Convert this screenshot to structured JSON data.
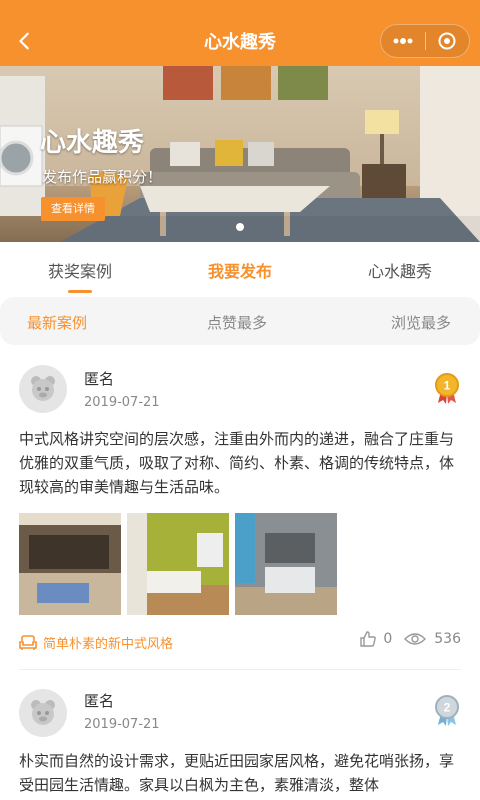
{
  "header": {
    "title": "心水趣秀"
  },
  "banner": {
    "title": "心水趣秀",
    "subtitle": "发布作品赢积分！",
    "button": "查看详情"
  },
  "tabs": [
    {
      "label": "获奖案例"
    },
    {
      "label": "我要发布"
    },
    {
      "label": "心水趣秀"
    }
  ],
  "filters": [
    {
      "label": "最新案例"
    },
    {
      "label": "点赞最多"
    },
    {
      "label": "浏览最多"
    }
  ],
  "posts": [
    {
      "author": "匿名",
      "date": "2019-07-21",
      "badge": "1",
      "content": "中式风格讲究空间的层次感，注重由外而内的递进，融合了庄重与优雅的双重气质，吸取了对称、简约、朴素、格调的传统特点，体现较高的审美情趣与生活品味。",
      "tag": "简单朴素的新中式风格",
      "likes": "0",
      "views": "536"
    },
    {
      "author": "匿名",
      "date": "2019-07-21",
      "badge": "2",
      "content": "朴实而自然的设计需求，更贴近田园家居风格，避免花哨张扬，享受田园生活情趣。家具以白枫为主色，素雅清淡，整体"
    }
  ],
  "colors": {
    "accent": "#f7912e"
  }
}
